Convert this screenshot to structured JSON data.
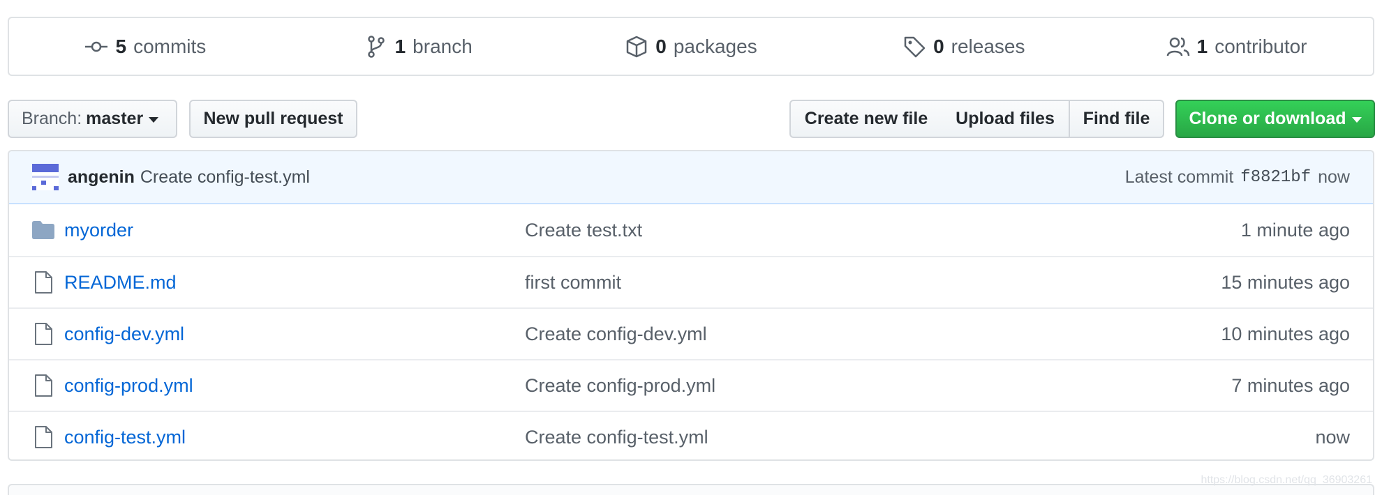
{
  "summary": {
    "commits": {
      "count": "5",
      "label": "commits",
      "icon": "commit-icon"
    },
    "branches": {
      "count": "1",
      "label": "branch",
      "icon": "branch-icon"
    },
    "packages": {
      "count": "0",
      "label": "packages",
      "icon": "package-icon"
    },
    "releases": {
      "count": "0",
      "label": "releases",
      "icon": "tag-icon"
    },
    "contributors": {
      "count": "1",
      "label": "contributor",
      "icon": "people-icon"
    }
  },
  "toolbar": {
    "branch_prefix": "Branch:",
    "branch_name": "master",
    "new_pr": "New pull request",
    "create_file": "Create new file",
    "upload_files": "Upload files",
    "find_file": "Find file",
    "clone": "Clone or download"
  },
  "commit": {
    "author": "angenin",
    "message": "Create config-test.yml",
    "latest_label": "Latest commit",
    "sha": "f8821bf",
    "time": "now"
  },
  "files": [
    {
      "type": "folder",
      "name": "myorder",
      "message": "Create test.txt",
      "age": "1 minute ago"
    },
    {
      "type": "file",
      "name": "README.md",
      "message": "first commit",
      "age": "15 minutes ago"
    },
    {
      "type": "file",
      "name": "config-dev.yml",
      "message": "Create config-dev.yml",
      "age": "10 minutes ago"
    },
    {
      "type": "file",
      "name": "config-prod.yml",
      "message": "Create config-prod.yml",
      "age": "7 minutes ago"
    },
    {
      "type": "file",
      "name": "config-test.yml",
      "message": "Create config-test.yml",
      "age": "now"
    }
  ],
  "watermark": "https://blog.csdn.net/qq_36903261",
  "colors": {
    "link": "#0366d6",
    "clone_button": "#28a745",
    "commit_bar": "#f1f8ff",
    "folder_icon": "#79b8ff"
  }
}
